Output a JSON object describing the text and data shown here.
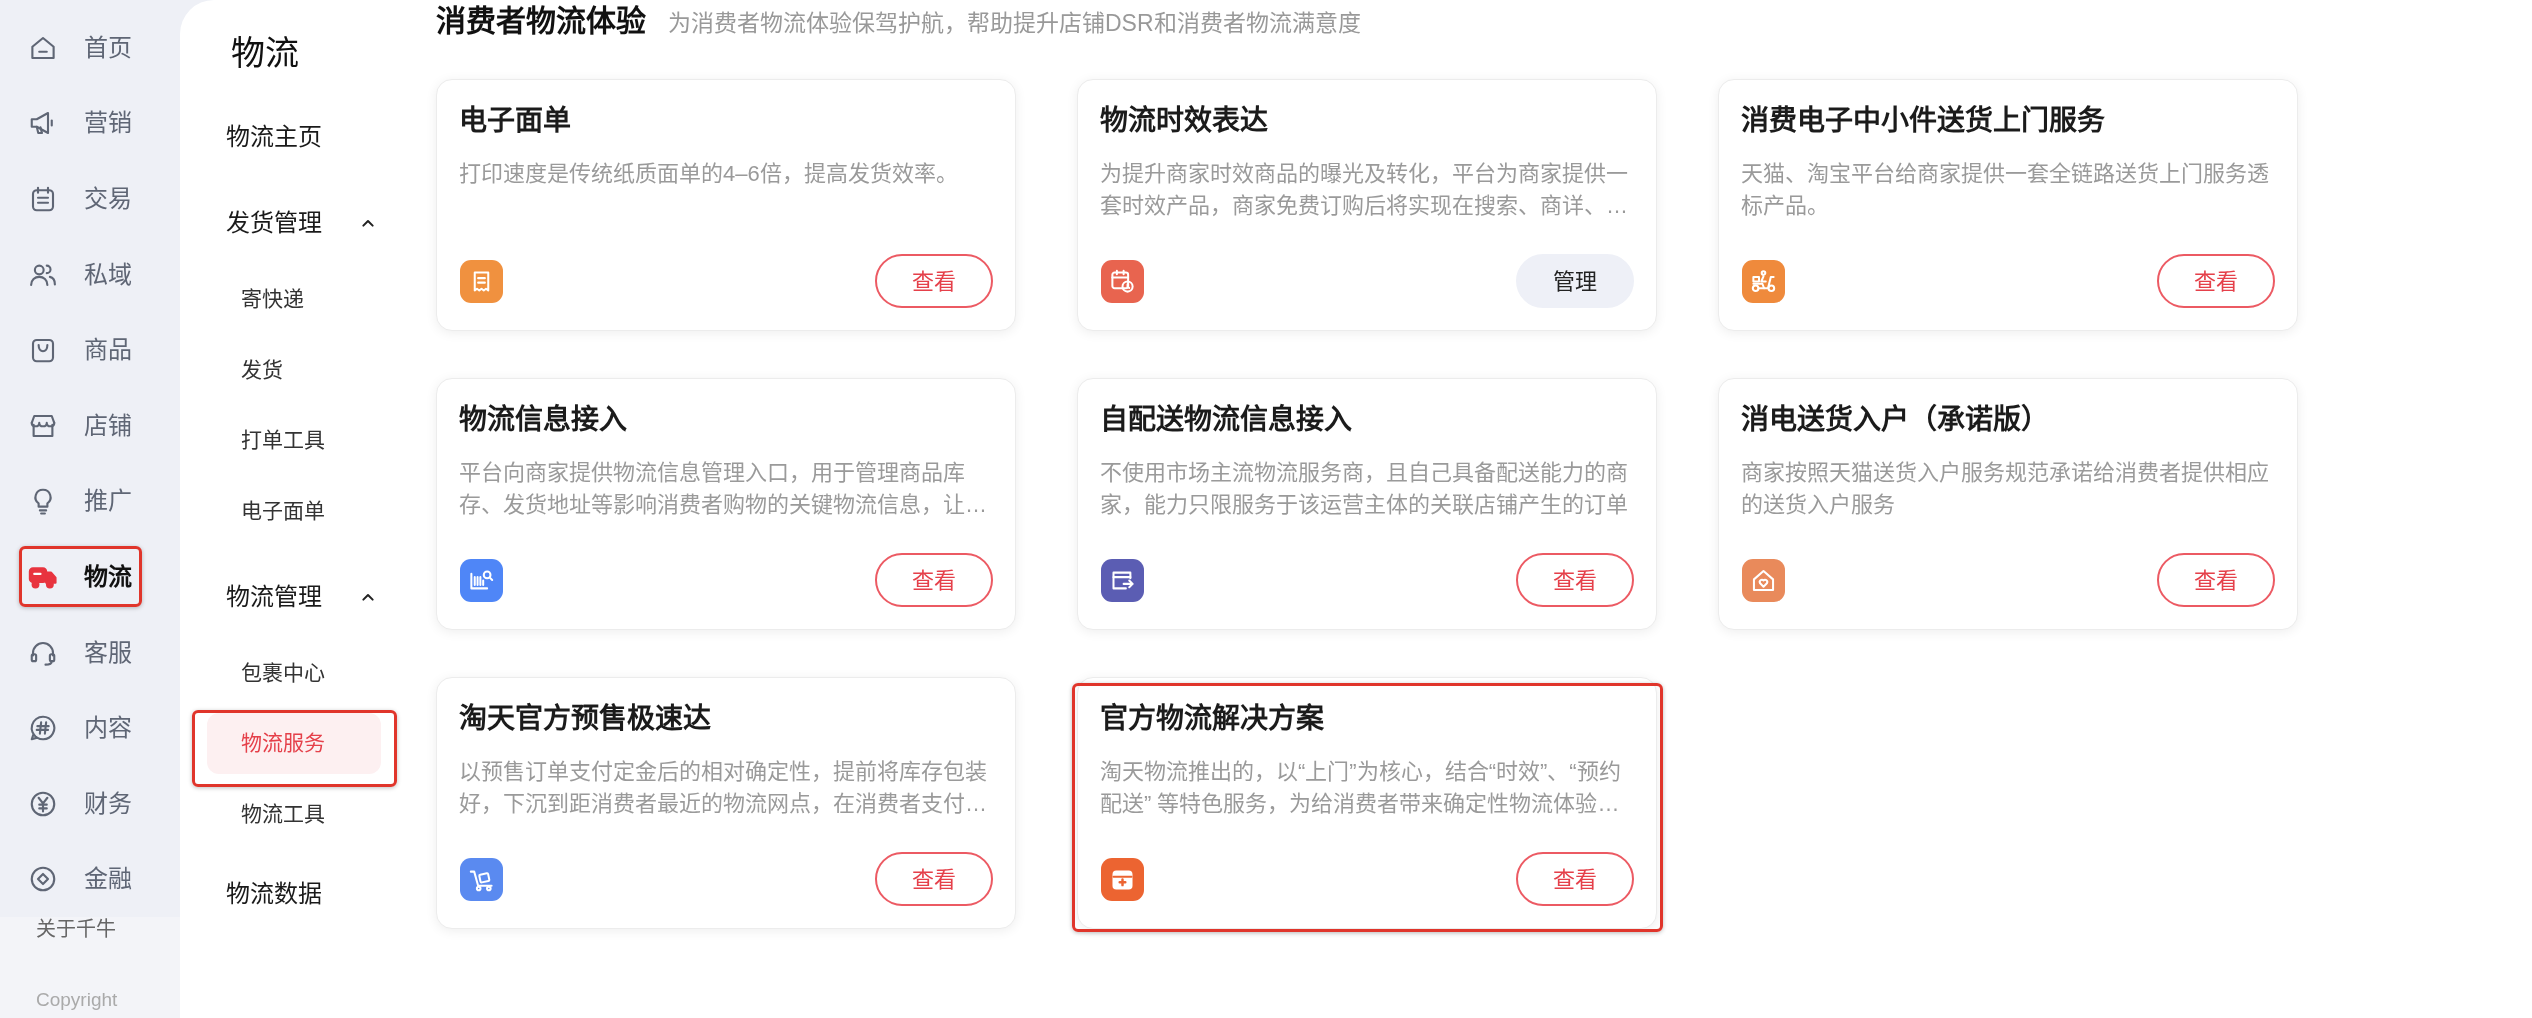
{
  "rail": {
    "items": [
      {
        "label": "首页",
        "selected": false,
        "highlighted": false
      },
      {
        "label": "营销",
        "selected": false,
        "highlighted": false
      },
      {
        "label": "交易",
        "selected": false,
        "highlighted": false
      },
      {
        "label": "私域",
        "selected": false,
        "highlighted": false
      },
      {
        "label": "商品",
        "selected": false,
        "highlighted": false
      },
      {
        "label": "店铺",
        "selected": false,
        "highlighted": false
      },
      {
        "label": "推广",
        "selected": false,
        "highlighted": false
      },
      {
        "label": "物流",
        "selected": true,
        "highlighted": true
      },
      {
        "label": "客服",
        "selected": false,
        "highlighted": false
      },
      {
        "label": "内容",
        "selected": false,
        "highlighted": false
      },
      {
        "label": "财务",
        "selected": false,
        "highlighted": false
      },
      {
        "label": "金融",
        "selected": false,
        "highlighted": false
      }
    ],
    "about": "关于千牛",
    "copyright": "Copyright"
  },
  "subnav": {
    "title": "物流",
    "items": [
      {
        "kind": "link",
        "label": "物流主页",
        "selected": false
      },
      {
        "kind": "group",
        "label": "发货管理",
        "expanded": true,
        "children": [
          {
            "label": "寄快递",
            "selected": false,
            "highlighted": false
          },
          {
            "label": "发货",
            "selected": false,
            "highlighted": false
          },
          {
            "label": "打单工具",
            "selected": false,
            "highlighted": false
          },
          {
            "label": "电子面单",
            "selected": false,
            "highlighted": false
          }
        ]
      },
      {
        "kind": "group",
        "label": "物流管理",
        "expanded": true,
        "children": [
          {
            "label": "包裹中心",
            "selected": false,
            "highlighted": false
          },
          {
            "label": "物流服务",
            "selected": true,
            "highlighted": true
          },
          {
            "label": "物流工具",
            "selected": false,
            "highlighted": false
          }
        ]
      },
      {
        "kind": "link",
        "label": "物流数据",
        "selected": false
      }
    ]
  },
  "section": {
    "title": "消费者物流体验",
    "subtitle": "为消费者物流体验保驾护航，帮助提升店铺DSR和消费者物流满意度",
    "cards": [
      {
        "title": "电子面单",
        "description": "打印速度是传统纸质面单的4–6倍，提高发货效率。",
        "color": "#f0913f",
        "highlighted": false,
        "action": {
          "kind": "outline",
          "label": "查看"
        }
      },
      {
        "title": "物流时效表达",
        "description": "为提升商家时效商品的曝光及转化，平台为商家提供一套时效产品，商家免费订购后将实现在搜索、商详、…",
        "color": "#e8644f",
        "highlighted": false,
        "action": {
          "kind": "muted",
          "label": "管理"
        }
      },
      {
        "title": "消费电子中小件送货上门服务",
        "description": "天猫、淘宝平台给商家提供一套全链路送货上门服务透标产品。",
        "color": "#ef8a3c",
        "highlighted": false,
        "action": {
          "kind": "outline",
          "label": "查看"
        }
      },
      {
        "title": "物流信息接入",
        "description": "平台向商家提供物流信息管理入口，用于管理商品库存、发货地址等影响消费者购物的关键物流信息，让…",
        "color": "#4f86f7",
        "highlighted": false,
        "action": {
          "kind": "outline",
          "label": "查看"
        }
      },
      {
        "title": "自配送物流信息接入",
        "description": "不使用市场主流物流服务商，且自己具备配送能力的商家，能力只限服务于该运营主体的关联店铺产生的订单",
        "color": "#5b5db3",
        "highlighted": false,
        "action": {
          "kind": "outline",
          "label": "查看"
        }
      },
      {
        "title": "消电送货入户（承诺版）",
        "description": "商家按照天猫送货入户服务规范承诺给消费者提供相应的送货入户服务",
        "color": "#e98a5b",
        "highlighted": false,
        "action": {
          "kind": "outline",
          "label": "查看"
        }
      },
      {
        "title": "淘天官方预售极速达",
        "description": "以预售订单支付定金后的相对确定性，提前将库存包装好，下沉到距消费者最近的物流网点，在消费者支付…",
        "color": "#5a8af0",
        "highlighted": false,
        "action": {
          "kind": "outline",
          "label": "查看"
        }
      },
      {
        "title": "官方物流解决方案",
        "description": "淘天物流推出的，以“上门”为核心，结合“时效”、“预约配送” 等特色服务，为给消费者带来确定性物流体验…",
        "color": "#ec6431",
        "highlighted": true,
        "action": {
          "kind": "outline",
          "label": "查看"
        }
      }
    ]
  }
}
